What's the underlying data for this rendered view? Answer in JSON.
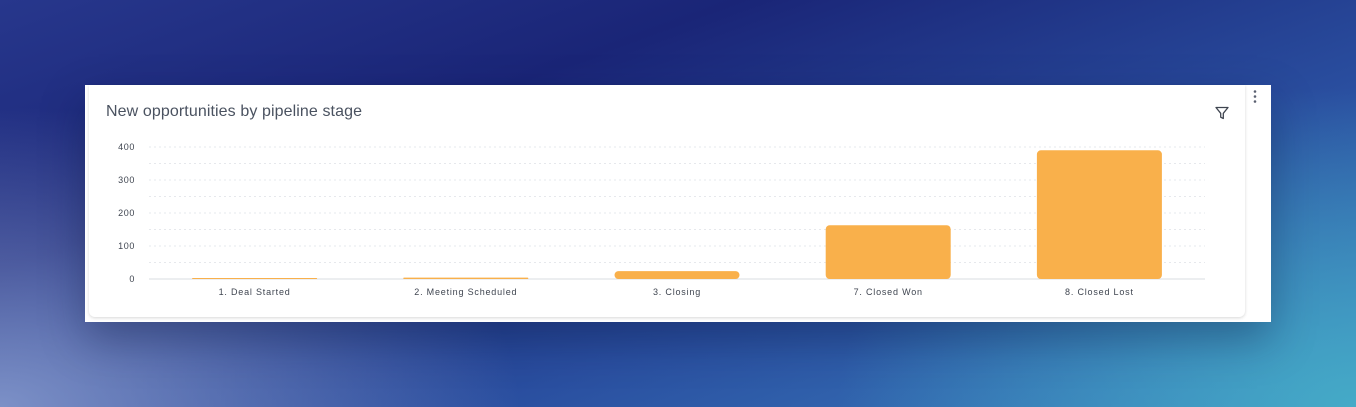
{
  "widget": {
    "title": "New opportunities by pipeline stage",
    "filter_icon": "filter-icon",
    "menu_icon": "more-vertical-icon"
  },
  "colors": {
    "bar": "#f9b04b",
    "grid": "#e6e8ec",
    "text": "#3f4550"
  },
  "chart_data": {
    "type": "bar",
    "title": "New opportunities by pipeline stage",
    "xlabel": "",
    "ylabel": "",
    "categories": [
      "1. Deal Started",
      "2. Meeting Scheduled",
      "3. Closing",
      "7. Closed Won",
      "8. Closed Lost"
    ],
    "values": [
      2,
      4,
      24,
      163,
      390
    ],
    "ylim": [
      0,
      400
    ],
    "yticks": [
      "0",
      "100",
      "200",
      "300",
      "400"
    ],
    "grid": true,
    "legend": "none"
  }
}
